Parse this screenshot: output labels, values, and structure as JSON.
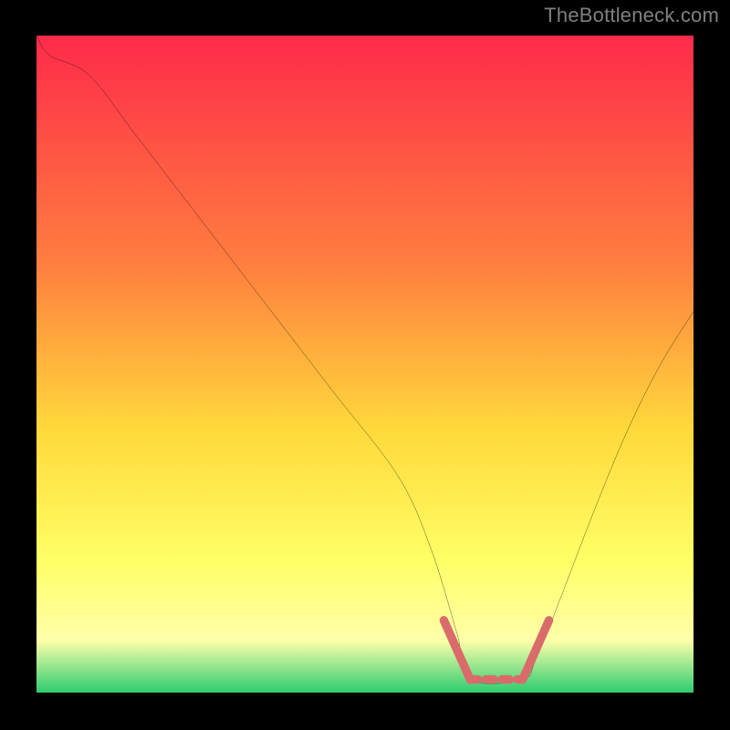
{
  "watermark": {
    "text": "TheBottleneck.com"
  },
  "chart_data": {
    "type": "line",
    "title": "",
    "xlabel": "",
    "ylabel": "",
    "xlim": [
      0,
      100
    ],
    "ylim": [
      0,
      100
    ],
    "background_gradient": {
      "top": "#FF2A4A",
      "mid1": "#FF7F3F",
      "mid2": "#FFD93B",
      "mid3": "#FFFF66",
      "mid4": "#FFFFAA",
      "bottom": "#2ECC71"
    },
    "series": [
      {
        "name": "curve",
        "x": [
          0,
          2,
          8,
          15,
          25,
          35,
          45,
          55,
          60,
          64,
          66,
          74,
          76,
          80,
          85,
          90,
          95,
          100
        ],
        "y": [
          100,
          97,
          94,
          85,
          72,
          59,
          46,
          33,
          22,
          9,
          2,
          2,
          5,
          15,
          28,
          40,
          50,
          58
        ]
      }
    ],
    "highlights": [
      {
        "name": "band-left",
        "stroke": "#D96B6B",
        "points": [
          [
            62,
            11
          ],
          [
            66,
            2
          ]
        ]
      },
      {
        "name": "band-flat",
        "stroke": "#D96B6B",
        "points": [
          [
            66,
            2
          ],
          [
            74,
            2
          ]
        ]
      },
      {
        "name": "band-right",
        "stroke": "#D96B6B",
        "points": [
          [
            74,
            2
          ],
          [
            78,
            11
          ]
        ]
      }
    ]
  }
}
